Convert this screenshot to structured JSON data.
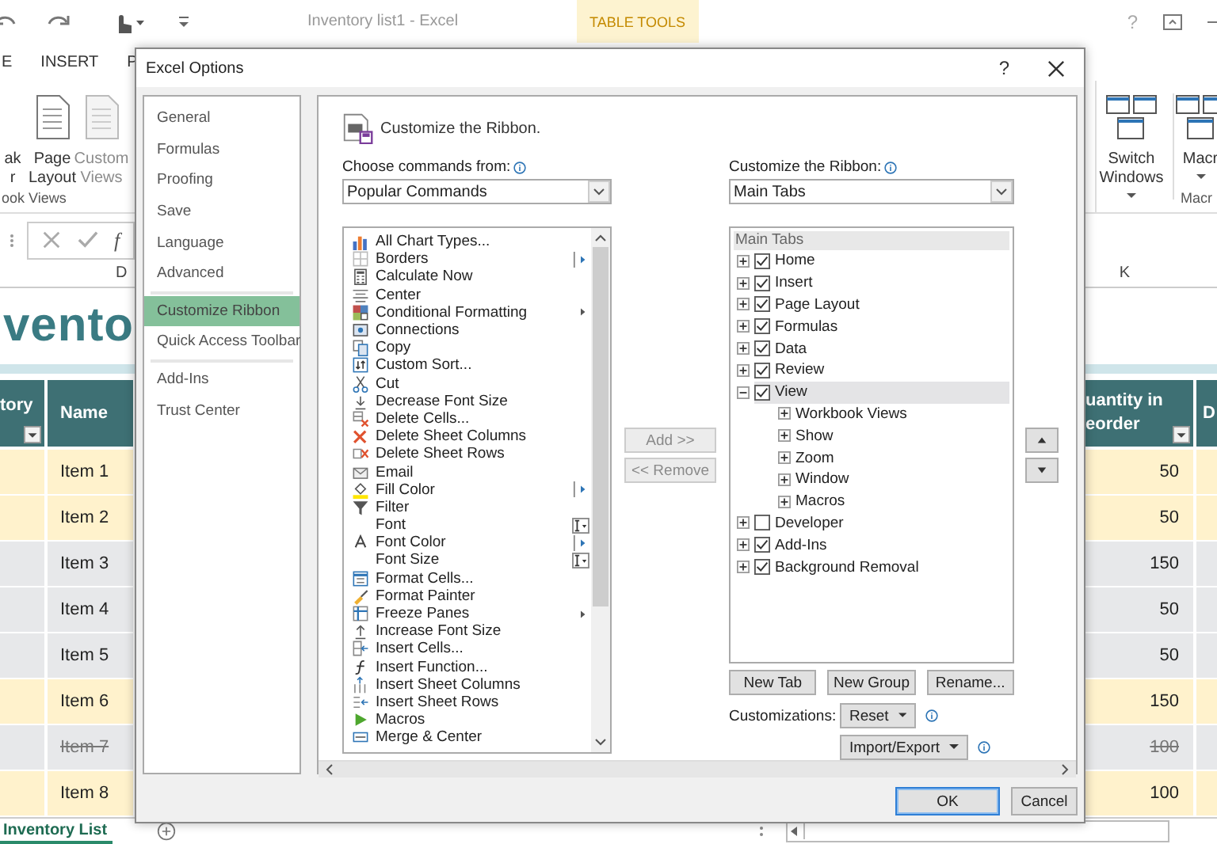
{
  "excel": {
    "title": "Inventory list1 - Excel",
    "contextual_tab": "TABLE TOOLS",
    "help": "?",
    "ribbon_tabs": [
      "E",
      "INSERT",
      "P"
    ],
    "ribbon_left": [
      {
        "lines": [
          "ak",
          "r"
        ],
        "disabled": false
      },
      {
        "lines": [
          "Page",
          "Layout"
        ],
        "disabled": false
      },
      {
        "lines": [
          "Custom",
          "Views"
        ],
        "disabled": true
      }
    ],
    "ribbon_left_group": "ook Views",
    "ribbon_right": [
      {
        "lines": [
          "Switch",
          "Windows"
        ]
      },
      {
        "lines": [
          "Macr"
        ]
      }
    ],
    "ribbon_right_group": "Macr",
    "formula_symbol": "f",
    "column_left": "D",
    "column_right": "K",
    "sheet_title": "vento",
    "headers_left": [
      {
        "lines": [
          "tory"
        ],
        "filter": true
      },
      {
        "lines": [
          "Name"
        ],
        "filter": false
      }
    ],
    "headers_right": [
      {
        "lines": [
          "uantity in",
          "eorder"
        ],
        "filter": true
      },
      {
        "lines": [
          "D"
        ],
        "filter": false
      }
    ],
    "rows": [
      {
        "name": "Item 1",
        "quantity": "50",
        "flagged": true,
        "discontinued": false
      },
      {
        "name": "Item 2",
        "quantity": "50",
        "flagged": true,
        "discontinued": false
      },
      {
        "name": "Item 3",
        "quantity": "150",
        "flagged": false,
        "discontinued": false
      },
      {
        "name": "Item 4",
        "quantity": "50",
        "flagged": false,
        "discontinued": false
      },
      {
        "name": "Item 5",
        "quantity": "50",
        "flagged": false,
        "discontinued": false
      },
      {
        "name": "Item 6",
        "quantity": "150",
        "flagged": true,
        "discontinued": false
      },
      {
        "name": "Item 7",
        "quantity": "100",
        "flagged": false,
        "discontinued": true
      },
      {
        "name": "Item 8",
        "quantity": "100",
        "flagged": true,
        "discontinued": false
      }
    ],
    "sheet_tab": "Inventory List"
  },
  "dialog": {
    "title": "Excel Options",
    "help": "?",
    "nav_groups": [
      [
        {
          "label": "General",
          "selected": false
        },
        {
          "label": "Formulas",
          "selected": false
        },
        {
          "label": "Proofing",
          "selected": false
        },
        {
          "label": "Save",
          "selected": false
        },
        {
          "label": "Language",
          "selected": false
        },
        {
          "label": "Advanced",
          "selected": false
        }
      ],
      [
        {
          "label": "Customize Ribbon",
          "selected": true
        },
        {
          "label": "Quick Access Toolbar",
          "selected": false
        }
      ],
      [
        {
          "label": "Add-Ins",
          "selected": false
        },
        {
          "label": "Trust Center",
          "selected": false
        }
      ]
    ],
    "page_title": "Customize the Ribbon.",
    "commands_label": "Choose commands from:",
    "commands_source": "Popular Commands",
    "commands": [
      {
        "label": "All Chart Types...",
        "kind": "plain"
      },
      {
        "label": "Borders",
        "kind": "split"
      },
      {
        "label": "Calculate Now",
        "kind": "plain"
      },
      {
        "label": "Center",
        "kind": "plain"
      },
      {
        "label": "Conditional Formatting",
        "kind": "menu"
      },
      {
        "label": "Connections",
        "kind": "plain"
      },
      {
        "label": "Copy",
        "kind": "plain"
      },
      {
        "label": "Custom Sort...",
        "kind": "plain"
      },
      {
        "label": "Cut",
        "kind": "plain"
      },
      {
        "label": "Decrease Font Size",
        "kind": "plain"
      },
      {
        "label": "Delete Cells...",
        "kind": "plain"
      },
      {
        "label": "Delete Sheet Columns",
        "kind": "plain"
      },
      {
        "label": "Delete Sheet Rows",
        "kind": "plain"
      },
      {
        "label": "Email",
        "kind": "plain"
      },
      {
        "label": "Fill Color",
        "kind": "split"
      },
      {
        "label": "Filter",
        "kind": "plain"
      },
      {
        "label": "Font",
        "kind": "combo"
      },
      {
        "label": "Font Color",
        "kind": "split"
      },
      {
        "label": "Font Size",
        "kind": "combo"
      },
      {
        "label": "Format Cells...",
        "kind": "plain"
      },
      {
        "label": "Format Painter",
        "kind": "plain"
      },
      {
        "label": "Freeze Panes",
        "kind": "menu"
      },
      {
        "label": "Increase Font Size",
        "kind": "plain"
      },
      {
        "label": "Insert Cells...",
        "kind": "plain"
      },
      {
        "label": "Insert Function...",
        "kind": "plain"
      },
      {
        "label": "Insert Sheet Columns",
        "kind": "plain"
      },
      {
        "label": "Insert Sheet Rows",
        "kind": "plain"
      },
      {
        "label": "Macros",
        "kind": "plain"
      },
      {
        "label": "Merge & Center",
        "kind": "plain"
      }
    ],
    "add_button": {
      "label": "Add >>",
      "disabled": true
    },
    "remove_button": {
      "label": "<< Remove",
      "disabled": true
    },
    "ribbon_label": "Customize the Ribbon:",
    "ribbon_source": "Main Tabs",
    "tree_header": "Main Tabs",
    "tree": [
      {
        "label": "Home",
        "checked": true,
        "expanded": false,
        "selected": false
      },
      {
        "label": "Insert",
        "checked": true,
        "expanded": false,
        "selected": false
      },
      {
        "label": "Page Layout",
        "checked": true,
        "expanded": false,
        "selected": false
      },
      {
        "label": "Formulas",
        "checked": true,
        "expanded": false,
        "selected": false
      },
      {
        "label": "Data",
        "checked": true,
        "expanded": false,
        "selected": false
      },
      {
        "label": "Review",
        "checked": true,
        "expanded": false,
        "selected": false
      },
      {
        "label": "View",
        "checked": true,
        "expanded": true,
        "selected": true,
        "children": [
          {
            "label": "Workbook Views",
            "expanded": false,
            "selected": false
          },
          {
            "label": "Show",
            "expanded": false,
            "selected": false
          },
          {
            "label": "Zoom",
            "expanded": false,
            "selected": false
          },
          {
            "label": "Window",
            "expanded": false,
            "selected": false
          },
          {
            "label": "Macros",
            "expanded": false,
            "selected": false
          }
        ]
      },
      {
        "label": "Developer",
        "checked": false,
        "expanded": false,
        "selected": false
      },
      {
        "label": "Add-Ins",
        "checked": true,
        "expanded": false,
        "selected": false
      },
      {
        "label": "Background Removal",
        "checked": true,
        "expanded": false,
        "selected": false
      }
    ],
    "tree_buttons": [
      "New Tab",
      "New Group",
      "Rename..."
    ],
    "customizations_label": "Customizations:",
    "reset": "Reset",
    "import_export": "Import/Export",
    "ok": {
      "label": "OK",
      "default": true
    },
    "cancel": "Cancel"
  }
}
